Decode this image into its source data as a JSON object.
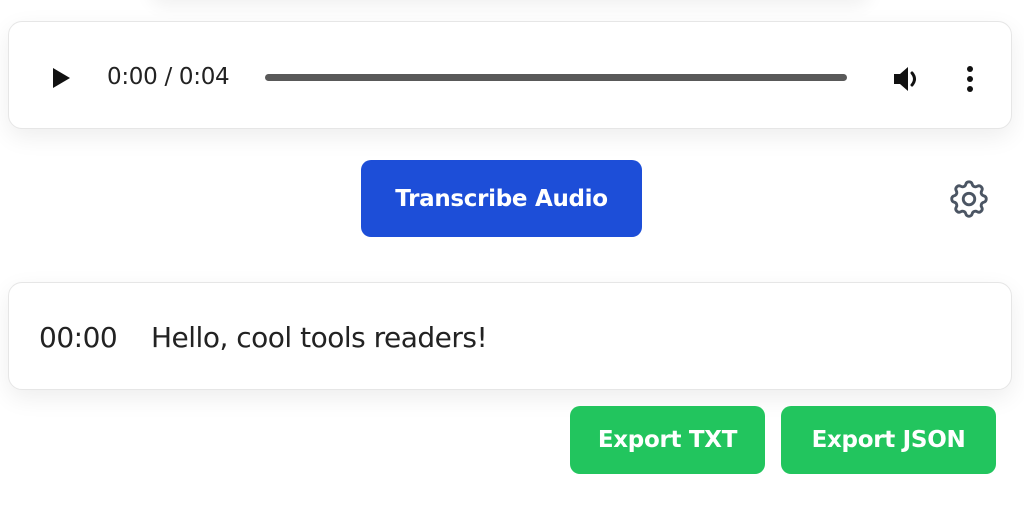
{
  "player": {
    "time_display": "0:00 / 0:04",
    "progress": 0.0,
    "play_icon": "play-icon",
    "volume_icon": "volume-icon",
    "more_icon": "more-vertical-icon"
  },
  "actions": {
    "transcribe_label": "Transcribe Audio",
    "settings_icon": "gear-icon"
  },
  "transcript": {
    "segments": [
      {
        "time": "00:00",
        "text": "Hello, cool tools readers!"
      }
    ]
  },
  "export": {
    "txt_label": "Export TXT",
    "json_label": "Export JSON"
  },
  "colors": {
    "primary": "#1d4ed8",
    "success": "#22c55e",
    "text": "#222222",
    "track": "#595959"
  }
}
